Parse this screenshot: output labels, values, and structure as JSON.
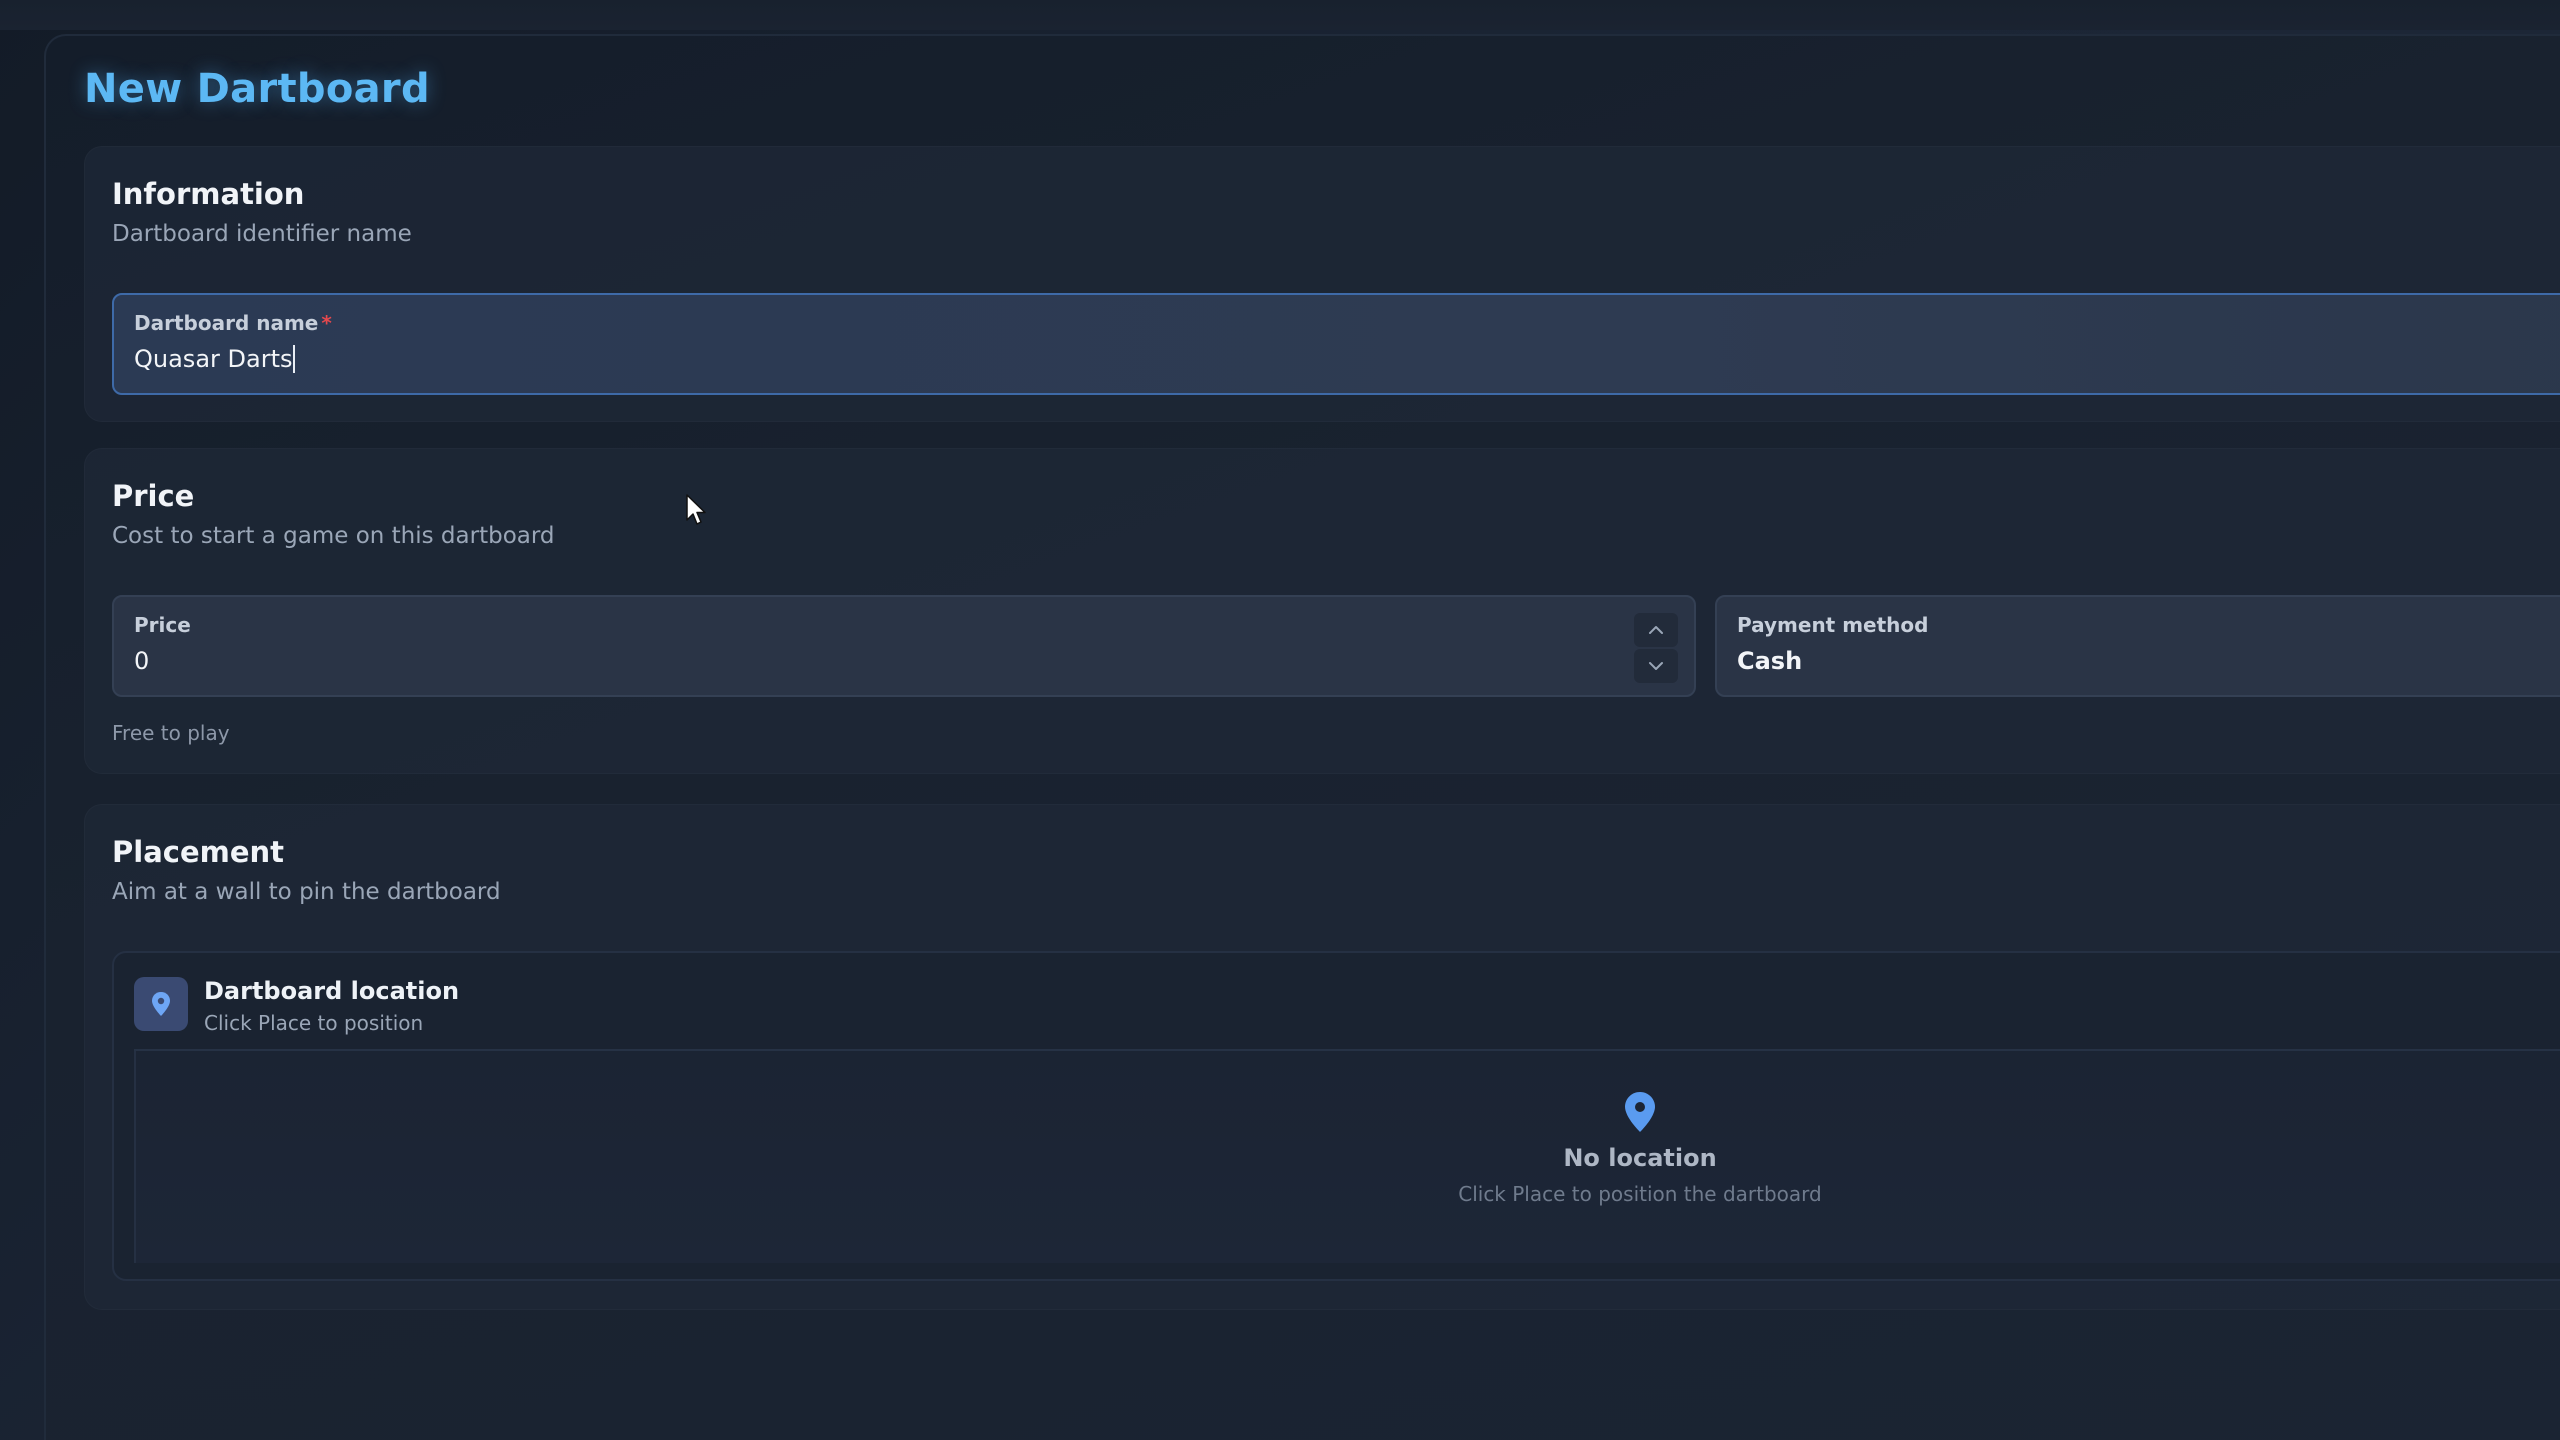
{
  "page": {
    "title": "New Dartboard"
  },
  "information": {
    "title": "Information",
    "subtitle": "Dartboard identifier name",
    "name_field": {
      "label": "Dartboard name",
      "required_mark": "*",
      "value": "Quasar Darts"
    }
  },
  "price": {
    "title": "Price",
    "subtitle": "Cost to start a game on this dartboard",
    "price_field": {
      "label": "Price",
      "value": "0"
    },
    "payment_field": {
      "label": "Payment method",
      "value": "Cash"
    },
    "helper": "Free to play"
  },
  "placement": {
    "title": "Placement",
    "subtitle": "Aim at a wall to pin the dartboard",
    "location": {
      "title": "Dartboard location",
      "subtitle": "Click Place to position",
      "icon": "map-pin-icon"
    },
    "empty": {
      "title": "No location",
      "subtitle": "Click Place to position the dartboard",
      "icon": "map-pin-icon"
    }
  },
  "colors": {
    "accent": "#5cb8f4",
    "pin": "#5a9bf0",
    "required": "#e5484d"
  }
}
